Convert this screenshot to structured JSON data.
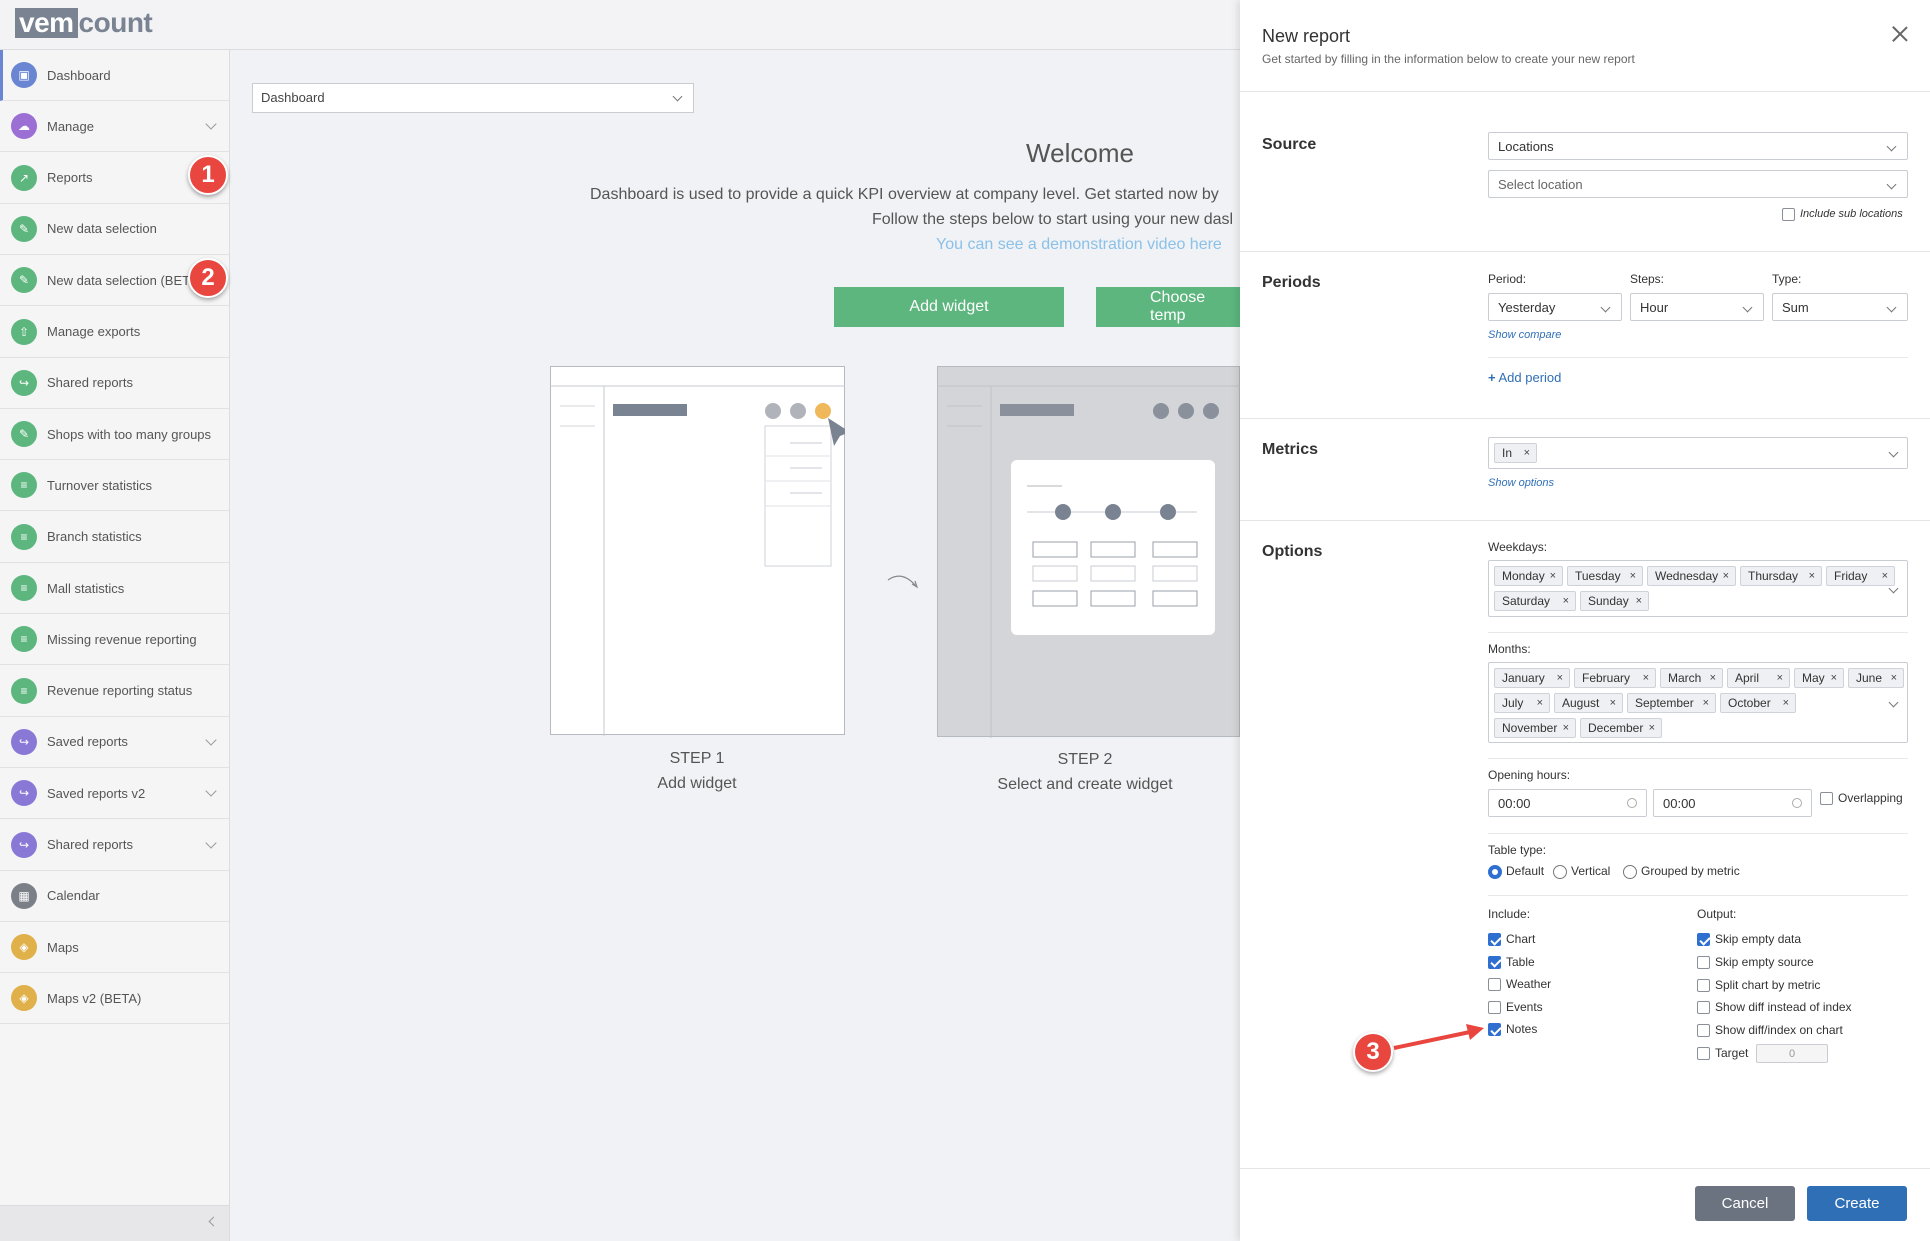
{
  "app": {
    "logo_box": "vem",
    "logo_rest": "count"
  },
  "sidebar": {
    "items": [
      {
        "label": "Dashboard",
        "icon": "dashboard-icon",
        "color": "#6a86d3",
        "active": true
      },
      {
        "label": "Manage",
        "icon": "cloud-icon",
        "color": "#9b6fd3",
        "chevron": true
      },
      {
        "label": "Reports",
        "icon": "chart-icon",
        "color": "#5cb67d"
      },
      {
        "label": "New data selection",
        "icon": "edit-icon",
        "color": "#5cb67d"
      },
      {
        "label": "New data selection (BETA)",
        "icon": "edit-icon",
        "color": "#5cb67d"
      },
      {
        "label": "Manage exports",
        "icon": "upload-icon",
        "color": "#5cb67d"
      },
      {
        "label": "Shared reports",
        "icon": "share-icon",
        "color": "#5cb67d"
      },
      {
        "label": "Shops with too many groups",
        "icon": "edit-icon",
        "color": "#5cb67d"
      },
      {
        "label": "Turnover statistics",
        "icon": "document-icon",
        "color": "#5cb67d"
      },
      {
        "label": "Branch statistics",
        "icon": "document-icon",
        "color": "#5cb67d"
      },
      {
        "label": "Mall statistics",
        "icon": "document-icon",
        "color": "#5cb67d"
      },
      {
        "label": "Missing revenue reporting",
        "icon": "document-icon",
        "color": "#5cb67d"
      },
      {
        "label": "Revenue reporting status",
        "icon": "document-icon",
        "color": "#5cb67d"
      },
      {
        "label": "Saved reports",
        "icon": "share-icon",
        "color": "#8a78d6",
        "chevron": true
      },
      {
        "label": "Saved reports v2",
        "icon": "share-icon",
        "color": "#8a78d6",
        "chevron": true
      },
      {
        "label": "Shared reports",
        "icon": "share-icon",
        "color": "#8a78d6",
        "chevron": true
      },
      {
        "label": "Calendar",
        "icon": "calendar-icon",
        "color": "#7b7f87"
      },
      {
        "label": "Maps",
        "icon": "map-icon",
        "color": "#e0b04a"
      },
      {
        "label": "Maps v2 (BETA)",
        "icon": "map-icon",
        "color": "#e0b04a"
      }
    ]
  },
  "annotations": {
    "badge1": "1",
    "badge2": "2",
    "badge3": "3"
  },
  "main": {
    "dashboard_select": "Dashboard",
    "welcome": "Welcome",
    "intro_line1": "Dashboard is used to provide a quick KPI overview at company level. Get started now by",
    "intro_line2": "Follow the steps below to start using your new dasl",
    "demo_link": "You can see a demonstration video here",
    "add_widget_button": "Add widget",
    "choose_template_button": "Choose temp",
    "step1_title": "STEP 1",
    "step1_desc": "Add widget",
    "step2_title": "STEP 2",
    "step2_desc": "Select and create widget"
  },
  "modal": {
    "title": "New report",
    "subtitle": "Get started by filling in the information below to create your new report",
    "source": {
      "title": "Source",
      "source_value": "Locations",
      "location_placeholder": "Select location",
      "include_sub": "Include sub locations",
      "include_sub_checked": false
    },
    "periods": {
      "title": "Periods",
      "period_label": "Period:",
      "period_value": "Yesterday",
      "steps_label": "Steps:",
      "steps_value": "Hour",
      "type_label": "Type:",
      "type_value": "Sum",
      "show_compare": "Show compare",
      "add_period": "Add period"
    },
    "metrics": {
      "title": "Metrics",
      "tags": [
        "In"
      ],
      "show_options": "Show options"
    },
    "options": {
      "title": "Options",
      "weekdays_label": "Weekdays:",
      "weekdays": [
        "Monday",
        "Tuesday",
        "Wednesday",
        "Thursday",
        "Friday",
        "Saturday",
        "Sunday"
      ],
      "months_label": "Months:",
      "months": [
        "January",
        "February",
        "March",
        "April",
        "May",
        "June",
        "July",
        "August",
        "September",
        "October",
        "November",
        "December"
      ],
      "opening_hours_label": "Opening hours:",
      "open_from": "00:00",
      "open_to": "00:00",
      "overlapping": "Overlapping",
      "table_type_label": "Table type:",
      "table_types": [
        {
          "label": "Default",
          "selected": true
        },
        {
          "label": "Vertical",
          "selected": false
        },
        {
          "label": "Grouped by metric",
          "selected": false
        }
      ],
      "include_label": "Include:",
      "include": [
        {
          "label": "Chart",
          "checked": true
        },
        {
          "label": "Table",
          "checked": true
        },
        {
          "label": "Weather",
          "checked": false
        },
        {
          "label": "Events",
          "checked": false
        },
        {
          "label": "Notes",
          "checked": true
        }
      ],
      "output_label": "Output:",
      "output": [
        {
          "label": "Skip empty data",
          "checked": true
        },
        {
          "label": "Skip empty source",
          "checked": false
        },
        {
          "label": "Split chart by metric",
          "checked": false
        },
        {
          "label": "Show diff instead of index",
          "checked": false
        },
        {
          "label": "Show diff/index on chart",
          "checked": false
        },
        {
          "label": "Target",
          "checked": false
        }
      ],
      "target_value": "0"
    },
    "cancel": "Cancel",
    "create": "Create"
  }
}
